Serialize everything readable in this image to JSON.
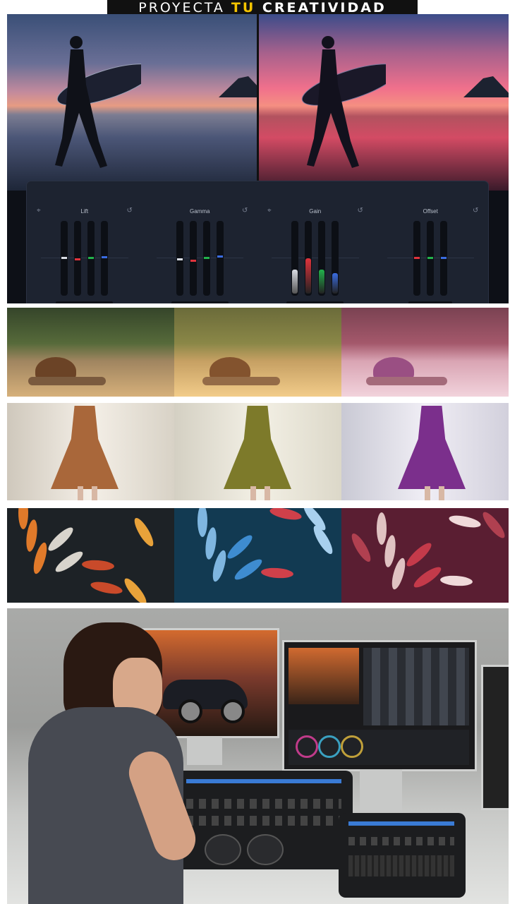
{
  "banner": {
    "word1": "PROYECTA ",
    "word2": "TU",
    "word3": " CREATIVIDAD"
  },
  "color_panel": {
    "groups": [
      {
        "title": "Lift",
        "values": [
          "0.00",
          "-0.04",
          "0.00",
          "0.02"
        ]
      },
      {
        "title": "Gamma",
        "values": [
          "-0.04",
          "-0.09",
          "0.00",
          "0.05"
        ]
      },
      {
        "title": "Gain",
        "values": [
          "1.00",
          "1.46",
          "1.00",
          "0.85"
        ]
      },
      {
        "title": "Offset",
        "values": [
          "25.00",
          "25.00",
          "25.00"
        ]
      }
    ],
    "channel_colors": {
      "master": "#d9dde5",
      "red": "#e0333c",
      "green": "#22b24c",
      "blue": "#3a6ce0"
    }
  },
  "icons": {
    "reset": "reset-icon",
    "crosshair": "crosshair-icon"
  },
  "colors": {
    "banner_bg": "#111111",
    "banner_accent": "#f4c400",
    "panel_bg": "#1d2330"
  }
}
